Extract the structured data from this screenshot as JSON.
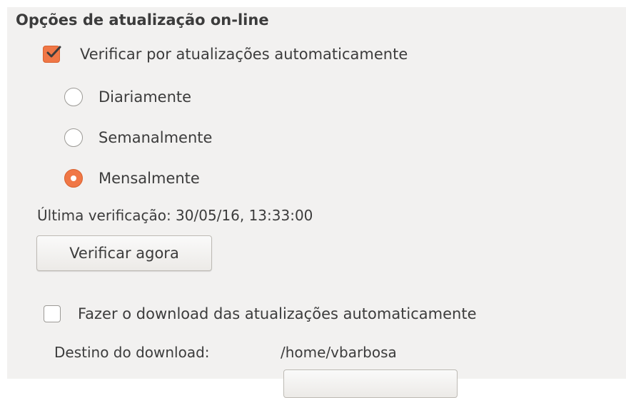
{
  "section": {
    "heading": "Opções de atualização on-line"
  },
  "auto_check": {
    "label": "Verificar por atualizações automaticamente",
    "checked": true
  },
  "frequency": {
    "daily": {
      "label": "Diariamente",
      "selected": false
    },
    "weekly": {
      "label": "Semanalmente",
      "selected": false
    },
    "monthly": {
      "label": "Mensalmente",
      "selected": true
    }
  },
  "last_check": {
    "text": "Última verificação: 30/05/16, 13:33:00"
  },
  "check_now_button": {
    "label": "Verificar agora"
  },
  "auto_download": {
    "label": "Fazer o download das atualizações automaticamente",
    "checked": false
  },
  "download_destination": {
    "label": "Destino do download:",
    "path": "/home/vbarbosa"
  },
  "colors": {
    "accent": "#f07746",
    "background": "#f2f1f0",
    "text": "#3c3c3c"
  },
  "icons": {
    "checkmark": "check-icon"
  }
}
